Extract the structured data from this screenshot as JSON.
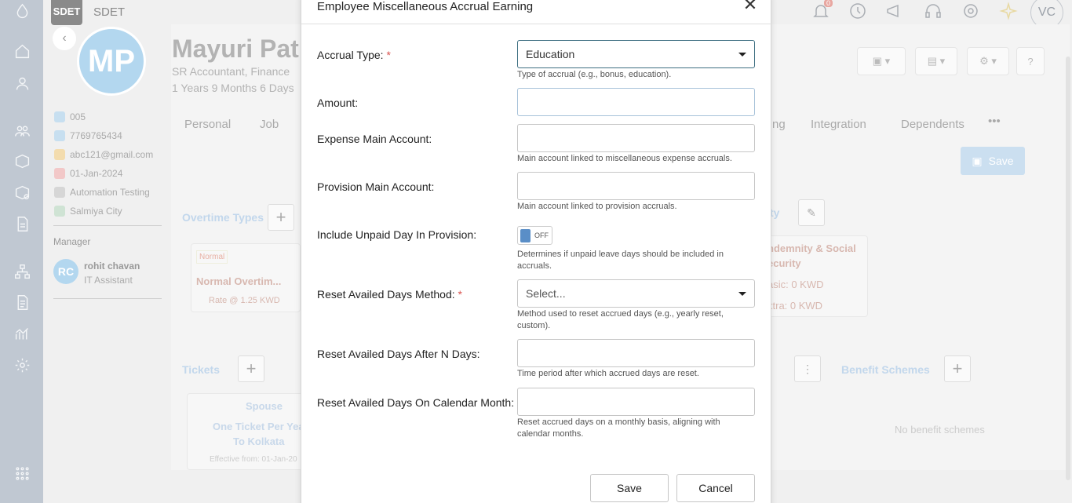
{
  "topbar": {
    "badge": "SDET",
    "company": "SDET",
    "notification_count": "0",
    "user_initials": "VC"
  },
  "employee": {
    "initials": "MP",
    "name": "Mayuri Pati",
    "title": "SR Accountant, Finance",
    "tenure": "1 Years 9 Months 6 Days",
    "id": "005",
    "phone": "7769765434",
    "email": "abc121@gmail.com",
    "date": "01-Jan-2024",
    "department": "Automation Testing",
    "location": "Salmiya City"
  },
  "manager": {
    "label": "Manager",
    "initials": "RC",
    "name": "rohit chavan",
    "role": "IT Assistant"
  },
  "tabs": [
    "Personal",
    "Job",
    "ng",
    "Integration",
    "Dependents",
    "•••"
  ],
  "background": {
    "save_label": "Save",
    "overtime_title": "Overtime Types",
    "overtime_tag": "Normal",
    "overtime_name": "Normal Overtim...",
    "overtime_rate": "Rate @ 1.25 KWD",
    "indemnity_title": "ndemnity & Social",
    "indemnity_title2": "ecurity",
    "indemnity_basic": "asic: 0 KWD",
    "indemnity_extra": "xtra: 0 KWD",
    "tickets_title": "Tickets",
    "ticket_relation": "Spouse",
    "ticket_name1": "One Ticket Per Yea",
    "ticket_name2": "To Kolkata",
    "ticket_effective": "Effective from: 01-Jan-20",
    "benefit_title": "Benefit Schemes",
    "benefit_empty": "No benefit schemes",
    "ty_frag": "ty"
  },
  "modal": {
    "title": "Employee Miscellaneous Accrual Earning",
    "accrual_type": {
      "label": "Accrual Type:",
      "value": "Education",
      "hint": "Type of accrual (e.g., bonus, education)."
    },
    "amount": {
      "label": "Amount:",
      "value": ""
    },
    "expense_account": {
      "label": "Expense Main Account:",
      "value": "",
      "hint": "Main account linked to miscellaneous expense accruals."
    },
    "provision_account": {
      "label": "Provision Main Account:",
      "value": "",
      "hint": "Main account linked to provision accruals."
    },
    "include_unpaid": {
      "label": "Include Unpaid Day In Provision:",
      "state": "OFF",
      "hint": "Determines if unpaid leave days should be included in accruals."
    },
    "reset_method": {
      "label": "Reset Availed Days Method:",
      "placeholder": "Select...",
      "hint": "Method used to reset accrued days (e.g., yearly reset, custom)."
    },
    "reset_after": {
      "label": "Reset Availed Days After N Days:",
      "value": "",
      "hint": "Time period after which accrued days are reset."
    },
    "reset_calendar": {
      "label": "Reset Availed Days On Calendar Month:",
      "value": "",
      "hint": "Reset accrued days on a monthly basis, aligning with calendar months."
    },
    "save_label": "Save",
    "cancel_label": "Cancel",
    "required_mark": "*"
  },
  "colors": {
    "accent": "#4d7c8e",
    "toggle": "#5a8ec7",
    "required": "#d9534f"
  }
}
